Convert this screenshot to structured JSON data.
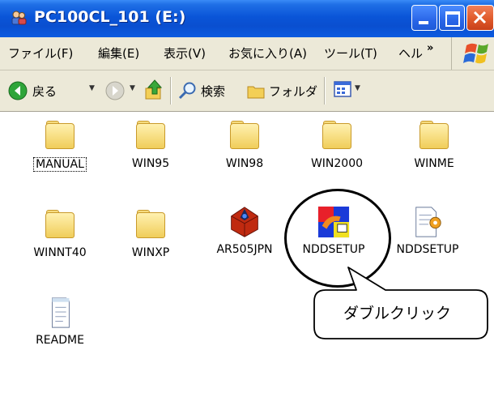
{
  "window": {
    "title": "PC100CL_101 (E:)"
  },
  "menu": [
    "ファイル(F)",
    "編集(E)",
    "表示(V)",
    "お気に入り(A)",
    "ツール(T)",
    "ヘル"
  ],
  "menu_overflow": "»",
  "toolbar": {
    "back": "戻る",
    "search": "検索",
    "folders": "フォルダ"
  },
  "files": [
    {
      "name": "MANUAL",
      "type": "folder"
    },
    {
      "name": "WIN95",
      "type": "folder"
    },
    {
      "name": "WIN98",
      "type": "folder"
    },
    {
      "name": "WIN2000",
      "type": "folder"
    },
    {
      "name": "WINME",
      "type": "folder"
    },
    {
      "name": "WINNT40",
      "type": "folder"
    },
    {
      "name": "WINXP",
      "type": "folder"
    },
    {
      "name": "AR505JPN",
      "type": "application"
    },
    {
      "name": "NDDSETUP",
      "type": "application"
    },
    {
      "name": "NDDSETUP",
      "type": "setup-info"
    },
    {
      "name": "README",
      "type": "text"
    }
  ],
  "annotation": {
    "callout": "ダブルクリック"
  },
  "colors": {
    "title_bar": "#0a55d8",
    "chrome": "#ece9d8",
    "close_button": "#e05a2a"
  }
}
